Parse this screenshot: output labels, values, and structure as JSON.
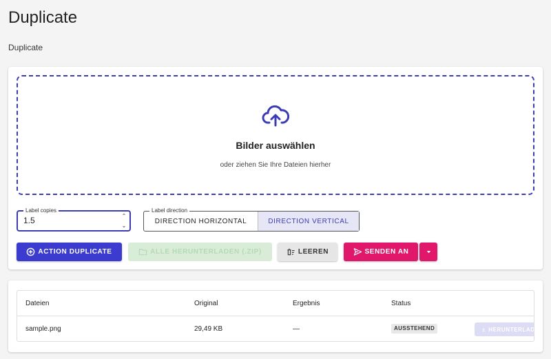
{
  "page": {
    "title": "Duplicate",
    "subtitle": "Duplicate"
  },
  "dropzone": {
    "icon": "cloud-upload-icon",
    "title": "Bilder auswählen",
    "subtitle": "oder ziehen Sie Ihre Dateien hierher"
  },
  "copies": {
    "label": "Label copies",
    "value": "1.5"
  },
  "direction": {
    "label": "Label direction",
    "horizontal": "DIRECTION HORIZONTAL",
    "vertical": "DIRECTION VERTICAL",
    "selected": "vertical"
  },
  "actions": {
    "duplicate": "ACTION DUPLICATE",
    "download_zip": "ALLE HERUNTERLADEN (.ZIP)",
    "clear": "LEEREN",
    "send": "SENDEN AN"
  },
  "table": {
    "headers": [
      "Dateien",
      "Original",
      "Ergebnis",
      "Status"
    ],
    "rows": [
      {
        "file": "sample.png",
        "original": "29,49 KB",
        "result": "—",
        "status": "AUSSTEHEND",
        "action": "HERUNTERLADEN"
      }
    ]
  },
  "colors": {
    "primary": "#3b3bd0",
    "accent": "#e0176a",
    "success_disabled": "#d8ecd8"
  }
}
